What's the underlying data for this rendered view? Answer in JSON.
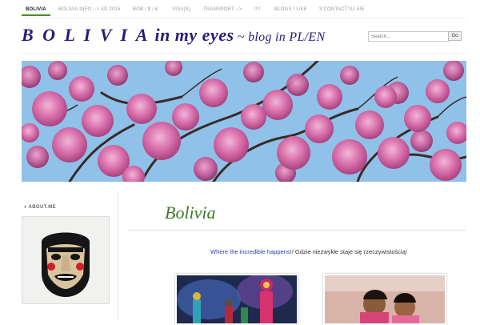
{
  "nav": {
    "items": [
      {
        "label": "BOLIVIA"
      },
      {
        "label": "BOLIVIA INFO --> AD 2015"
      },
      {
        "label": "BOB / $ / €"
      },
      {
        "label": "VISA(S)"
      },
      {
        "label": "TRANSPORT -->"
      },
      {
        "label": "!!!!"
      },
      {
        "label": "BLOGS I LIKE"
      },
      {
        "label": "S'CONTACT'UJ SIE"
      }
    ]
  },
  "site": {
    "title_main": "B O L I V I A",
    "title_rest": " in my eyes",
    "subtitle": " ~ blog in PL/EN"
  },
  "search": {
    "placeholder": "Search...",
    "button_label": "Go"
  },
  "sidebar": {
    "widget_title": "ABOUT.ME",
    "widget_bullet": "♦"
  },
  "main": {
    "page_title": "Bolivia",
    "tagline_en": "Where the incredible happens!",
    "tagline_sep": "/ ",
    "tagline_pl": "Gdzie niezwykłe staje się rzeczywistością!"
  },
  "colors": {
    "title": "#2a1a7a",
    "accent_green": "#3c7a26",
    "link_blue": "#2a3fa0",
    "sky": "#8fc1e9",
    "blossom": "#d96aa9"
  }
}
